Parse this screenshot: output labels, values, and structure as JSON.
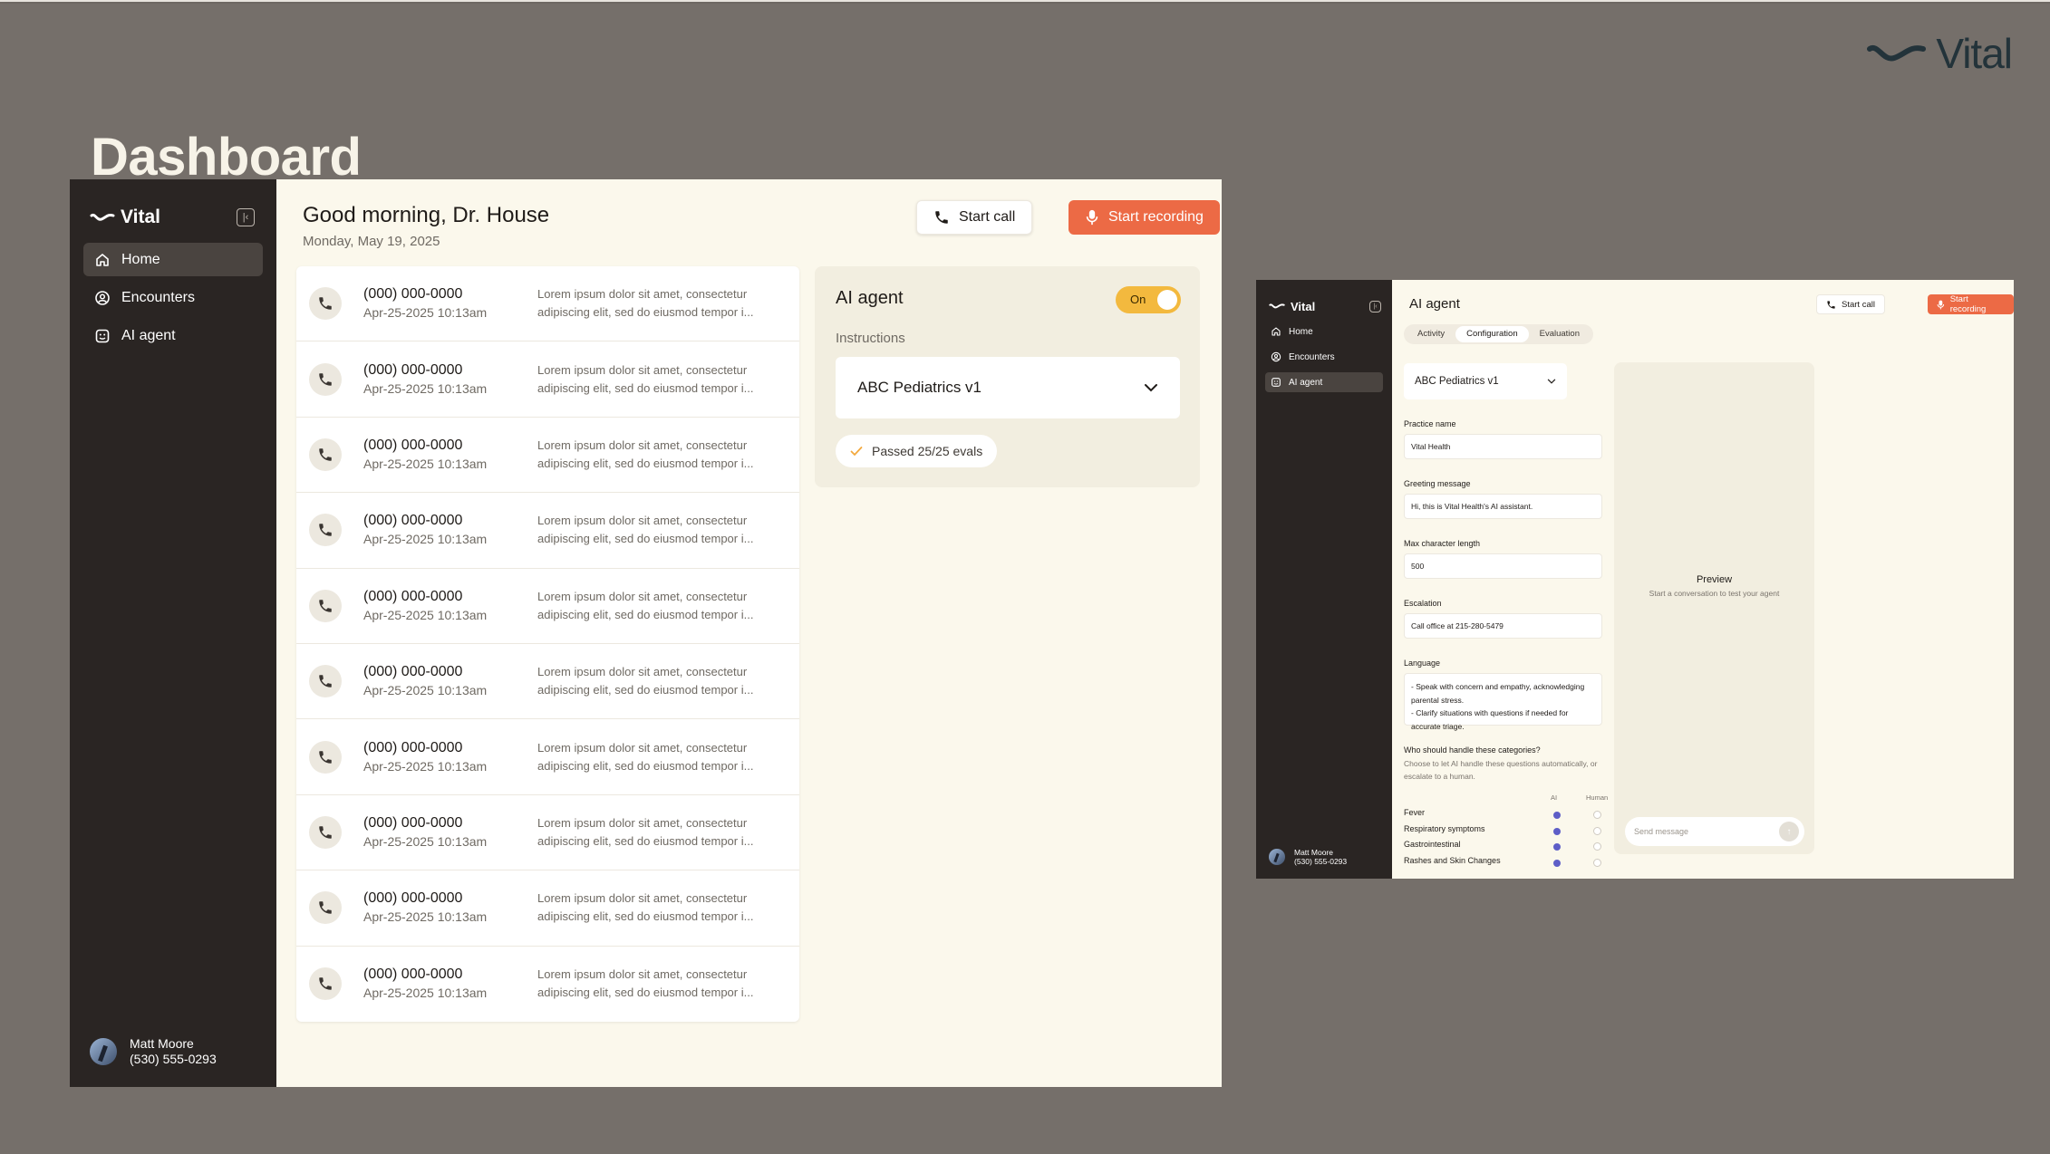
{
  "brand": {
    "name": "Vital"
  },
  "page": {
    "title": "Dashboard"
  },
  "sidebar": {
    "items": [
      {
        "label": "Home"
      },
      {
        "label": "Encounters"
      },
      {
        "label": "AI agent"
      }
    ],
    "user": {
      "name": "Matt Moore",
      "phone": "(530) 555-0293"
    }
  },
  "header": {
    "greeting": "Good morning, Dr. House",
    "date": "Monday, May 19, 2025",
    "start_call": "Start call",
    "start_recording": "Start recording"
  },
  "calls": [
    {
      "number": "(000) 000-0000",
      "time": "Apr-25-2025 10:13am",
      "summary": "Lorem ipsum dolor sit amet, consectetur",
      "summary2": "adipiscing elit, sed do eiusmod tempor i..."
    },
    {
      "number": "(000) 000-0000",
      "time": "Apr-25-2025 10:13am",
      "summary": "Lorem ipsum dolor sit amet, consectetur",
      "summary2": "adipiscing elit, sed do eiusmod tempor i..."
    },
    {
      "number": "(000) 000-0000",
      "time": "Apr-25-2025 10:13am",
      "summary": "Lorem ipsum dolor sit amet, consectetur",
      "summary2": "adipiscing elit, sed do eiusmod tempor i..."
    },
    {
      "number": "(000) 000-0000",
      "time": "Apr-25-2025 10:13am",
      "summary": "Lorem ipsum dolor sit amet, consectetur",
      "summary2": "adipiscing elit, sed do eiusmod tempor i..."
    },
    {
      "number": "(000) 000-0000",
      "time": "Apr-25-2025 10:13am",
      "summary": "Lorem ipsum dolor sit amet, consectetur",
      "summary2": "adipiscing elit, sed do eiusmod tempor i..."
    },
    {
      "number": "(000) 000-0000",
      "time": "Apr-25-2025 10:13am",
      "summary": "Lorem ipsum dolor sit amet, consectetur",
      "summary2": "adipiscing elit, sed do eiusmod tempor i..."
    },
    {
      "number": "(000) 000-0000",
      "time": "Apr-25-2025 10:13am",
      "summary": "Lorem ipsum dolor sit amet, consectetur",
      "summary2": "adipiscing elit, sed do eiusmod tempor i..."
    },
    {
      "number": "(000) 000-0000",
      "time": "Apr-25-2025 10:13am",
      "summary": "Lorem ipsum dolor sit amet, consectetur",
      "summary2": "adipiscing elit, sed do eiusmod tempor i..."
    },
    {
      "number": "(000) 000-0000",
      "time": "Apr-25-2025 10:13am",
      "summary": "Lorem ipsum dolor sit amet, consectetur",
      "summary2": "adipiscing elit, sed do eiusmod tempor i..."
    },
    {
      "number": "(000) 000-0000",
      "time": "Apr-25-2025 10:13am",
      "summary": "Lorem ipsum dolor sit amet, consectetur",
      "summary2": "adipiscing elit, sed do eiusmod tempor i..."
    }
  ],
  "agent_card": {
    "title": "AI agent",
    "toggle_label": "On",
    "instructions_label": "Instructions",
    "selected_instructions": "ABC Pediatrics v1",
    "evals_badge": "Passed 25/25 evals"
  },
  "config": {
    "title": "AI agent",
    "tabs": [
      "Activity",
      "Configuration",
      "Evaluation"
    ],
    "active_tab": "Configuration",
    "selected_version": "ABC Pediatrics v1",
    "fields": {
      "practice_name": {
        "label": "Practice name",
        "value": "Vital Health"
      },
      "greeting": {
        "label": "Greeting message",
        "value": "Hi, this is Vital Health's AI assistant."
      },
      "max_length": {
        "label": "Max character length",
        "value": "500"
      },
      "escalation": {
        "label": "Escalation",
        "value": "Call office at 215-280-5479"
      },
      "language": {
        "label": "Language",
        "value": "- Speak with concern and empathy, acknowledging parental stress.\n- Clarify situations with questions if needed for accurate triage."
      }
    },
    "categories_title": "Who should handle these categories?",
    "categories_subtitle": "Choose to let AI handle these questions automatically, or escalate to a human.",
    "col_ai": "AI",
    "col_human": "Human",
    "categories": [
      {
        "name": "Fever",
        "handler": "AI"
      },
      {
        "name": "Respiratory symptoms",
        "handler": "AI"
      },
      {
        "name": "Gastrointestinal",
        "handler": "AI"
      },
      {
        "name": "Rashes and Skin Changes",
        "handler": "AI"
      }
    ],
    "preview_title": "Preview",
    "preview_subtitle": "Start a conversation to test your agent",
    "message_placeholder": "Send message"
  },
  "colors": {
    "accent": "#ec6a45",
    "toggle": "#f3b93e",
    "sidebar": "#2a2523",
    "canvas": "#756f6a"
  }
}
